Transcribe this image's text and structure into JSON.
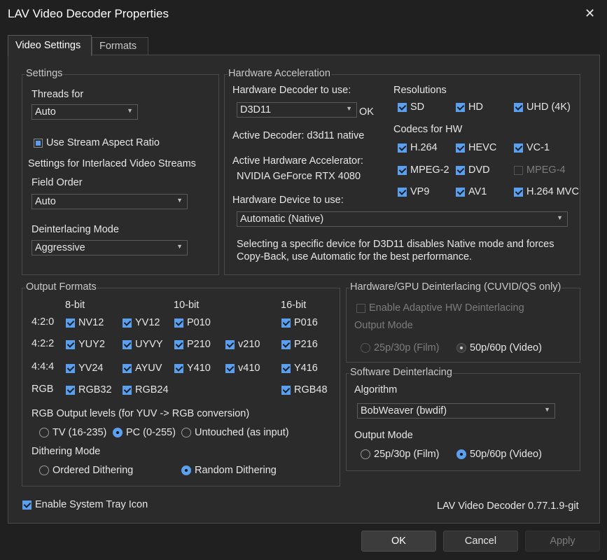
{
  "window": {
    "title": "LAV Video Decoder Properties"
  },
  "tabs": [
    "Video Settings",
    "Formats"
  ],
  "settings": {
    "legend": "Settings",
    "threads_label": "Threads for",
    "threads_value": "Auto",
    "stream_aspect": "Use Stream Aspect Ratio",
    "interlaced_heading": "Settings for Interlaced Video Streams",
    "field_order_label": "Field Order",
    "field_order_value": "Auto",
    "deint_mode_label": "Deinterlacing Mode",
    "deint_mode_value": "Aggressive"
  },
  "hw": {
    "legend": "Hardware Acceleration",
    "decoder_label": "Hardware Decoder to use:",
    "decoder_value": "D3D11",
    "decoder_status": "OK",
    "active_decoder": "Active Decoder:  d3d11 native",
    "active_accel_label": "Active Hardware Accelerator:",
    "active_accel_value": "NVIDIA GeForce RTX 4080",
    "device_label": "Hardware Device to use:",
    "device_value": "Automatic (Native)",
    "note": "Selecting a specific device for D3D11 disables Native mode and forces",
    "note2": "Copy-Back, use Automatic for the best performance.",
    "resolutions_label": "Resolutions",
    "resolutions": [
      "SD",
      "HD",
      "UHD (4K)"
    ],
    "codecs_label": "Codecs for HW",
    "codecs": [
      "H.264",
      "HEVC",
      "VC-1",
      "MPEG-2",
      "DVD",
      "MPEG-4",
      "VP9",
      "AV1",
      "H.264 MVC"
    ]
  },
  "output": {
    "legend": "Output Formats",
    "col_8bit": "8-bit",
    "col_10bit": "10-bit",
    "col_16bit": "16-bit",
    "row_420": "4:2:0",
    "row_422": "4:2:2",
    "row_444": "4:4:4",
    "row_rgb": "RGB",
    "fmt": {
      "nv12": "NV12",
      "yv12": "YV12",
      "p010": "P010",
      "p016": "P016",
      "yuy2": "YUY2",
      "uyvy": "UYVY",
      "p210": "P210",
      "v210": "v210",
      "p216": "P216",
      "yv24": "YV24",
      "ayuv": "AYUV",
      "y410": "Y410",
      "v410": "v410",
      "y416": "Y416",
      "rgb32": "RGB32",
      "rgb24": "RGB24",
      "rgb48": "RGB48"
    },
    "rgb_levels_label": "RGB Output levels (for YUV -> RGB conversion)",
    "levels": [
      "TV (16-235)",
      "PC (0-255)",
      "Untouched (as input)"
    ],
    "dither_label": "Dithering Mode",
    "dither": [
      "Ordered Dithering",
      "Random Dithering"
    ]
  },
  "hwdeint": {
    "legend": "Hardware/GPU Deinterlacing (CUVID/QS only)",
    "adaptive": "Enable Adaptive HW Deinterlacing",
    "output_mode_label": "Output Mode",
    "film": "25p/30p (Film)",
    "video": "50p/60p (Video)"
  },
  "swdeint": {
    "legend": "Software Deinterlacing",
    "algorithm_label": "Algorithm",
    "algorithm_value": "BobWeaver (bwdif)",
    "output_mode_label": "Output Mode",
    "film": "25p/30p (Film)",
    "video": "50p/60p (Video)"
  },
  "footer": {
    "tray": "Enable System Tray Icon",
    "version": "LAV Video Decoder 0.77.1.9-git"
  },
  "buttons": {
    "ok": "OK",
    "cancel": "Cancel",
    "apply": "Apply"
  }
}
